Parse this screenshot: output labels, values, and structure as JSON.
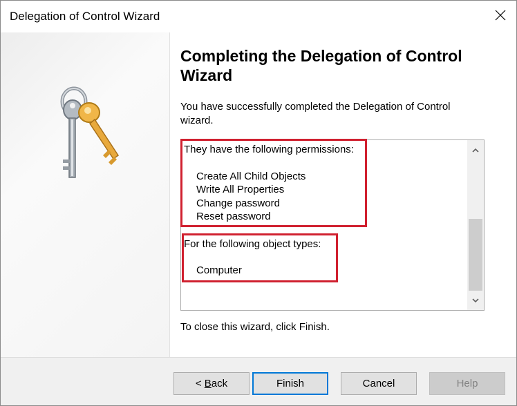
{
  "window": {
    "title": "Delegation of Control Wizard"
  },
  "heading": "Completing the Delegation of Control Wizard",
  "intro": "You have successfully completed the Delegation of Control wizard.",
  "summary": {
    "permissions_header": "They have the following permissions:",
    "permissions": [
      "Create All Child Objects",
      "Write All Properties",
      "Change password",
      "Reset password"
    ],
    "object_types_header": "For the following object types:",
    "object_types": [
      "Computer"
    ]
  },
  "footer_hint": "To close this wizard, click Finish.",
  "buttons": {
    "back": {
      "prefix": "< ",
      "mnemonic": "B",
      "rest": "ack"
    },
    "finish": "Finish",
    "cancel": "Cancel",
    "help": "Help"
  },
  "colors": {
    "highlight": "#d0202f",
    "default_button_border": "#0078d7",
    "key_gold": "#e8a93c",
    "key_silver": "#9aa3ad"
  },
  "icons": [
    "close-icon",
    "keys-icon",
    "scroll-up-icon",
    "scroll-down-icon"
  ]
}
